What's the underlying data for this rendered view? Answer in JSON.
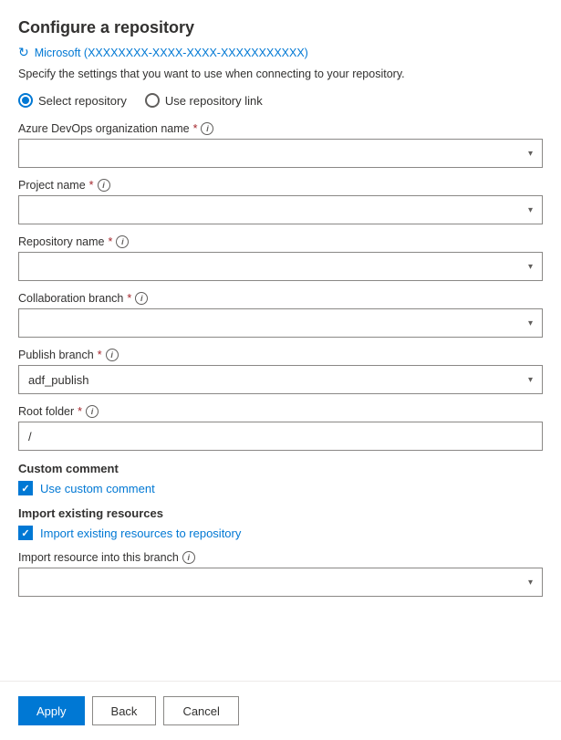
{
  "page": {
    "title": "Configure a repository",
    "account": "Microsoft (XXXXXXXX-XXXX-XXXX-XXXXXXXXXXX)",
    "description": "Specify the settings that you want to use when connecting to your repository."
  },
  "radio": {
    "option1": "Select repository",
    "option2": "Use repository link",
    "selected": "option1"
  },
  "fields": {
    "org_label": "Azure DevOps organization name",
    "org_value": "",
    "project_label": "Project name",
    "project_value": "",
    "repo_label": "Repository name",
    "repo_value": "",
    "collab_label": "Collaboration branch",
    "collab_value": "",
    "publish_label": "Publish branch",
    "publish_value": "adf_publish",
    "root_label": "Root folder",
    "root_value": "/",
    "import_branch_label": "Import resource into this branch",
    "import_branch_value": ""
  },
  "custom_comment": {
    "section_label": "Custom comment",
    "checkbox_label": "Use custom comment",
    "checked": true
  },
  "import_resources": {
    "section_label": "Import existing resources",
    "checkbox_label": "Import existing resources to repository",
    "checked": true
  },
  "footer": {
    "apply_label": "Apply",
    "back_label": "Back",
    "cancel_label": "Cancel"
  },
  "icons": {
    "info": "i",
    "chevron_down": "▾",
    "check": "✓",
    "refresh": "↻"
  }
}
